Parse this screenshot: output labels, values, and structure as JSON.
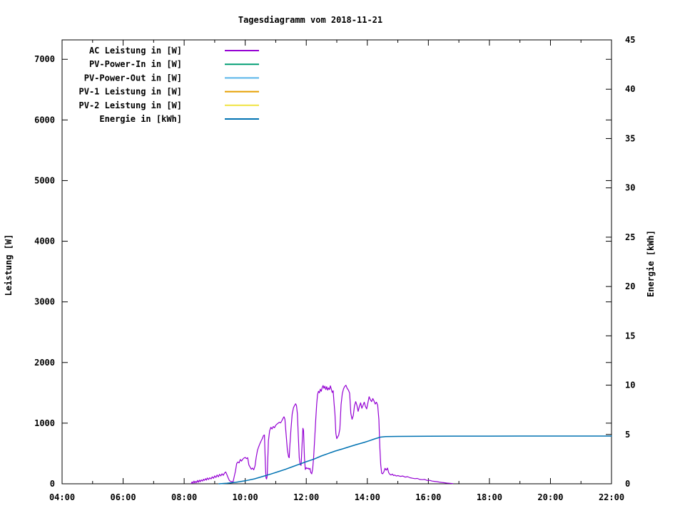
{
  "title": "Tagesdiagramm vom 2018-11-21",
  "axes": {
    "y1_label": "Leistung [W]",
    "y2_label": "Energie [kWh]"
  },
  "legend": {
    "items": [
      {
        "label": "AC Leistung in [W]",
        "color": "#9400d3"
      },
      {
        "label": "PV-Power-In in [W]",
        "color": "#009e73"
      },
      {
        "label": "PV-Power-Out in [W]",
        "color": "#56b4e9"
      },
      {
        "label": "PV-1 Leistung in [W]",
        "color": "#e69f00"
      },
      {
        "label": "PV-2 Leistung in [W]",
        "color": "#f0e442"
      },
      {
        "label": "Energie in [kWh]",
        "color": "#0072b2"
      }
    ]
  },
  "chart_data": {
    "type": "line",
    "title": "Tagesdiagramm vom 2018-11-21",
    "xlabel": "",
    "ylabel": "Leistung [W]",
    "y2label": "Energie [kWh]",
    "x_ticks": [
      {
        "t": 4,
        "label": "04:00"
      },
      {
        "t": 6,
        "label": "06:00"
      },
      {
        "t": 8,
        "label": "08:00"
      },
      {
        "t": 10,
        "label": "10:00"
      },
      {
        "t": 12,
        "label": "12:00"
      },
      {
        "t": 14,
        "label": "14:00"
      },
      {
        "t": 16,
        "label": "16:00"
      },
      {
        "t": 18,
        "label": "18:00"
      },
      {
        "t": 20,
        "label": "20:00"
      },
      {
        "t": 22,
        "label": "22:00"
      }
    ],
    "x_minor_ticks": [
      5,
      7,
      9,
      11,
      13,
      15,
      17,
      19,
      21
    ],
    "xlim": [
      4,
      22
    ],
    "y1_ticks": [
      0,
      1000,
      2000,
      3000,
      4000,
      5000,
      6000,
      7000
    ],
    "ylim": [
      0,
      7320
    ],
    "y2_ticks": [
      0,
      5,
      10,
      15,
      20,
      25,
      30,
      35,
      40,
      45
    ],
    "y2lim": [
      0,
      45
    ],
    "grid": false,
    "legend_position": "top-left-inside",
    "series": [
      {
        "name": "AC Leistung in [W]",
        "axis": "y1",
        "color": "#9400d3",
        "width": 1.2,
        "points": [
          [
            8.23,
            5
          ],
          [
            8.26,
            30
          ],
          [
            8.29,
            10
          ],
          [
            8.32,
            45
          ],
          [
            8.35,
            15
          ],
          [
            8.38,
            40
          ],
          [
            8.41,
            20
          ],
          [
            8.44,
            55
          ],
          [
            8.47,
            25
          ],
          [
            8.5,
            60
          ],
          [
            8.53,
            35
          ],
          [
            8.56,
            65
          ],
          [
            8.6,
            45
          ],
          [
            8.63,
            75
          ],
          [
            8.66,
            55
          ],
          [
            8.7,
            85
          ],
          [
            8.73,
            60
          ],
          [
            8.76,
            95
          ],
          [
            8.8,
            70
          ],
          [
            8.84,
            100
          ],
          [
            8.88,
            80
          ],
          [
            8.92,
            115
          ],
          [
            8.96,
            90
          ],
          [
            9.0,
            130
          ],
          [
            9.04,
            105
          ],
          [
            9.08,
            145
          ],
          [
            9.12,
            115
          ],
          [
            9.16,
            155
          ],
          [
            9.2,
            130
          ],
          [
            9.24,
            165
          ],
          [
            9.28,
            140
          ],
          [
            9.32,
            175
          ],
          [
            9.36,
            195
          ],
          [
            9.4,
            150
          ],
          [
            9.44,
            100
          ],
          [
            9.48,
            55
          ],
          [
            9.52,
            40
          ],
          [
            9.56,
            35
          ],
          [
            9.6,
            30
          ],
          [
            9.64,
            120
          ],
          [
            9.68,
            210
          ],
          [
            9.72,
            335
          ],
          [
            9.76,
            360
          ],
          [
            9.8,
            345
          ],
          [
            9.84,
            400
          ],
          [
            9.88,
            375
          ],
          [
            9.92,
            405
          ],
          [
            9.96,
            425
          ],
          [
            10.0,
            435
          ],
          [
            10.04,
            415
          ],
          [
            10.08,
            430
          ],
          [
            10.12,
            310
          ],
          [
            10.16,
            275
          ],
          [
            10.2,
            240
          ],
          [
            10.24,
            260
          ],
          [
            10.28,
            230
          ],
          [
            10.32,
            295
          ],
          [
            10.36,
            440
          ],
          [
            10.4,
            550
          ],
          [
            10.44,
            610
          ],
          [
            10.48,
            660
          ],
          [
            10.52,
            705
          ],
          [
            10.56,
            745
          ],
          [
            10.6,
            795
          ],
          [
            10.63,
            805
          ],
          [
            10.66,
            320
          ],
          [
            10.68,
            95
          ],
          [
            10.7,
            80
          ],
          [
            10.72,
            130
          ],
          [
            10.76,
            710
          ],
          [
            10.8,
            875
          ],
          [
            10.84,
            930
          ],
          [
            10.88,
            905
          ],
          [
            10.92,
            945
          ],
          [
            10.96,
            925
          ],
          [
            11.0,
            965
          ],
          [
            11.04,
            985
          ],
          [
            11.08,
            1000
          ],
          [
            11.12,
            1015
          ],
          [
            11.16,
            1005
          ],
          [
            11.2,
            1040
          ],
          [
            11.24,
            1080
          ],
          [
            11.27,
            1105
          ],
          [
            11.3,
            1065
          ],
          [
            11.34,
            810
          ],
          [
            11.38,
            565
          ],
          [
            11.42,
            445
          ],
          [
            11.44,
            430
          ],
          [
            11.46,
            605
          ],
          [
            11.5,
            905
          ],
          [
            11.54,
            1150
          ],
          [
            11.58,
            1255
          ],
          [
            11.62,
            1295
          ],
          [
            11.65,
            1320
          ],
          [
            11.68,
            1290
          ],
          [
            11.71,
            1150
          ],
          [
            11.74,
            780
          ],
          [
            11.77,
            430
          ],
          [
            11.8,
            315
          ],
          [
            11.83,
            305
          ],
          [
            11.86,
            610
          ],
          [
            11.89,
            915
          ],
          [
            11.91,
            880
          ],
          [
            11.94,
            420
          ],
          [
            11.97,
            235
          ],
          [
            12.0,
            265
          ],
          [
            12.03,
            250
          ],
          [
            12.06,
            260
          ],
          [
            12.09,
            240
          ],
          [
            12.12,
            255
          ],
          [
            12.15,
            185
          ],
          [
            12.18,
            165
          ],
          [
            12.21,
            245
          ],
          [
            12.24,
            430
          ],
          [
            12.28,
            780
          ],
          [
            12.31,
            1060
          ],
          [
            12.34,
            1310
          ],
          [
            12.37,
            1470
          ],
          [
            12.4,
            1525
          ],
          [
            12.43,
            1500
          ],
          [
            12.46,
            1560
          ],
          [
            12.49,
            1525
          ],
          [
            12.52,
            1585
          ],
          [
            12.55,
            1620
          ],
          [
            12.58,
            1575
          ],
          [
            12.61,
            1610
          ],
          [
            12.64,
            1555
          ],
          [
            12.67,
            1600
          ],
          [
            12.7,
            1545
          ],
          [
            12.73,
            1580
          ],
          [
            12.76,
            1555
          ],
          [
            12.79,
            1615
          ],
          [
            12.82,
            1560
          ],
          [
            12.85,
            1505
          ],
          [
            12.88,
            1535
          ],
          [
            12.91,
            1340
          ],
          [
            12.94,
            1155
          ],
          [
            12.97,
            830
          ],
          [
            13.0,
            745
          ],
          [
            13.03,
            775
          ],
          [
            13.06,
            800
          ],
          [
            13.1,
            905
          ],
          [
            13.14,
            1305
          ],
          [
            13.18,
            1485
          ],
          [
            13.22,
            1565
          ],
          [
            13.26,
            1605
          ],
          [
            13.3,
            1625
          ],
          [
            13.34,
            1575
          ],
          [
            13.38,
            1545
          ],
          [
            13.42,
            1495
          ],
          [
            13.46,
            1160
          ],
          [
            13.5,
            1065
          ],
          [
            13.54,
            1125
          ],
          [
            13.58,
            1285
          ],
          [
            13.62,
            1355
          ],
          [
            13.66,
            1295
          ],
          [
            13.7,
            1195
          ],
          [
            13.74,
            1275
          ],
          [
            13.78,
            1335
          ],
          [
            13.82,
            1245
          ],
          [
            13.86,
            1295
          ],
          [
            13.9,
            1345
          ],
          [
            13.94,
            1275
          ],
          [
            13.98,
            1235
          ],
          [
            14.02,
            1335
          ],
          [
            14.06,
            1435
          ],
          [
            14.1,
            1385
          ],
          [
            14.14,
            1355
          ],
          [
            14.18,
            1405
          ],
          [
            14.22,
            1365
          ],
          [
            14.26,
            1315
          ],
          [
            14.3,
            1345
          ],
          [
            14.34,
            1295
          ],
          [
            14.38,
            1060
          ],
          [
            14.41,
            610
          ],
          [
            14.44,
            310
          ],
          [
            14.47,
            175
          ],
          [
            14.5,
            165
          ],
          [
            14.54,
            195
          ],
          [
            14.58,
            255
          ],
          [
            14.62,
            225
          ],
          [
            14.66,
            260
          ],
          [
            14.7,
            185
          ],
          [
            14.74,
            155
          ],
          [
            14.78,
            145
          ],
          [
            14.82,
            160
          ],
          [
            14.86,
            135
          ],
          [
            14.9,
            145
          ],
          [
            14.95,
            128
          ],
          [
            15.0,
            135
          ],
          [
            15.08,
            122
          ],
          [
            15.16,
            128
          ],
          [
            15.24,
            110
          ],
          [
            15.32,
            118
          ],
          [
            15.4,
            100
          ],
          [
            15.48,
            92
          ],
          [
            15.56,
            85
          ],
          [
            15.64,
            88
          ],
          [
            15.72,
            72
          ],
          [
            15.8,
            68
          ],
          [
            15.88,
            72
          ],
          [
            15.96,
            55
          ],
          [
            16.04,
            58
          ],
          [
            16.12,
            45
          ],
          [
            16.2,
            40
          ],
          [
            16.28,
            35
          ],
          [
            16.36,
            28
          ],
          [
            16.44,
            22
          ],
          [
            16.52,
            18
          ],
          [
            16.6,
            12
          ],
          [
            16.7,
            8
          ],
          [
            16.8,
            4
          ]
        ]
      },
      {
        "name": "PV-Power-In in [W]",
        "axis": "y1",
        "color": "#009e73",
        "width": 1.2,
        "points": []
      },
      {
        "name": "PV-Power-Out in [W]",
        "axis": "y1",
        "color": "#56b4e9",
        "width": 1.2,
        "points": []
      },
      {
        "name": "PV-1 Leistung in [W]",
        "axis": "y1",
        "color": "#e69f00",
        "width": 1.2,
        "points": []
      },
      {
        "name": "PV-2 Leistung in [W]",
        "axis": "y1",
        "color": "#f0e442",
        "width": 1.2,
        "points": []
      },
      {
        "name": "Energie in [kWh]",
        "axis": "y2",
        "color": "#0072b2",
        "width": 1.5,
        "points": [
          [
            9.14,
            0
          ],
          [
            9.4,
            0.05
          ],
          [
            9.7,
            0.15
          ],
          [
            10.0,
            0.3
          ],
          [
            10.3,
            0.5
          ],
          [
            10.62,
            0.79
          ],
          [
            10.85,
            1.0
          ],
          [
            11.08,
            1.23
          ],
          [
            11.3,
            1.45
          ],
          [
            11.55,
            1.73
          ],
          [
            11.77,
            1.98
          ],
          [
            12.0,
            2.24
          ],
          [
            12.25,
            2.5
          ],
          [
            12.49,
            2.82
          ],
          [
            12.7,
            3.05
          ],
          [
            12.95,
            3.32
          ],
          [
            13.2,
            3.55
          ],
          [
            13.42,
            3.76
          ],
          [
            13.65,
            3.98
          ],
          [
            13.89,
            4.19
          ],
          [
            14.05,
            4.35
          ],
          [
            14.24,
            4.55
          ],
          [
            14.43,
            4.73
          ],
          [
            14.6,
            4.78
          ],
          [
            15.0,
            4.8
          ],
          [
            15.5,
            4.81
          ],
          [
            16.0,
            4.82
          ],
          [
            17.0,
            4.83
          ],
          [
            18.0,
            4.83
          ],
          [
            19.0,
            4.84
          ],
          [
            20.0,
            4.84
          ],
          [
            21.0,
            4.84
          ],
          [
            22.0,
            4.84
          ]
        ]
      }
    ]
  }
}
